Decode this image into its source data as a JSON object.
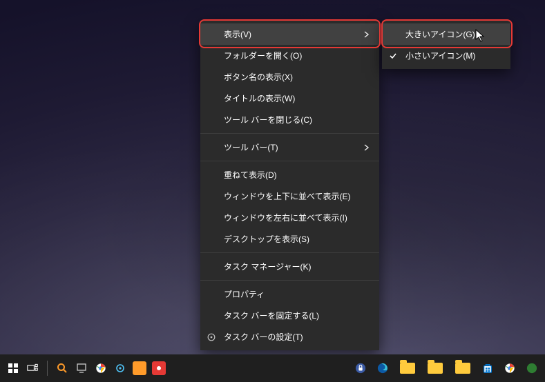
{
  "main_menu": {
    "view": "表示(V)",
    "open_folder": "フォルダーを開く(O)",
    "show_button_name": "ボタン名の表示(X)",
    "show_title": "タイトルの表示(W)",
    "close_toolbar": "ツール バーを閉じる(C)",
    "toolbars": "ツール バー(T)",
    "cascade": "重ねて表示(D)",
    "stack_vert": "ウィンドウを上下に並べて表示(E)",
    "stack_horiz": "ウィンドウを左右に並べて表示(I)",
    "show_desktop": "デスクトップを表示(S)",
    "task_manager": "タスク マネージャー(K)",
    "properties": "プロパティ",
    "lock_taskbar": "タスク バーを固定する(L)",
    "taskbar_settings": "タスク バーの設定(T)"
  },
  "submenu": {
    "large_icons": "大きいアイコン(G)",
    "small_icons": "小さいアイコン(M)"
  }
}
